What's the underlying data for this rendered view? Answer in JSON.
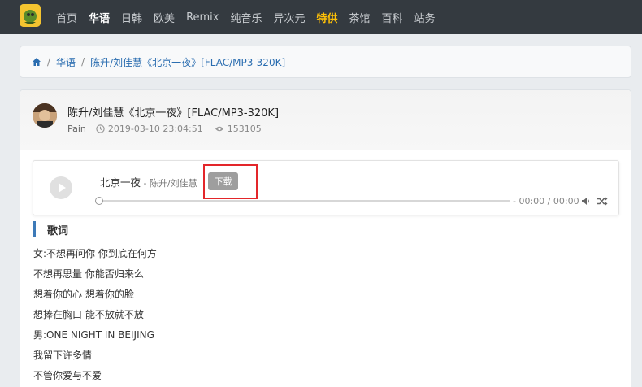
{
  "nav": {
    "items": [
      {
        "label": "首页"
      },
      {
        "label": "华语"
      },
      {
        "label": "日韩"
      },
      {
        "label": "欧美"
      },
      {
        "label": "Remix"
      },
      {
        "label": "纯音乐"
      },
      {
        "label": "异次元"
      },
      {
        "label": "特供"
      },
      {
        "label": "茶馆"
      },
      {
        "label": "百科"
      },
      {
        "label": "站务"
      }
    ],
    "active_index": 1,
    "highlight_index": 7
  },
  "breadcrumb": {
    "home_icon": "home-icon",
    "category": "华语",
    "current": "陈升/刘佳慧《北京一夜》[FLAC/MP3-320K]"
  },
  "post": {
    "title": "陈升/刘佳慧《北京一夜》[FLAC/MP3-320K]",
    "author": "Pain",
    "date": "2019-03-10 23:04:51",
    "views": "153105"
  },
  "player": {
    "song_title": "北京一夜",
    "artist": " - 陈升/刘佳慧",
    "download_label": "下载",
    "time": "- 00:00 / 00:00",
    "progress": 0
  },
  "lyrics": {
    "heading": "歌词",
    "lines": [
      "女:不想再问你 你到底在何方",
      "不想再思量 你能否归来么",
      "想着你的心 想着你的脸",
      "想捧在胸口 能不放就不放",
      "男:ONE NIGHT IN BEIJING",
      "我留下许多情",
      "不管你爱与不爱"
    ]
  },
  "colors": {
    "topbar": "#343a40",
    "accent": "#3d7ab8",
    "highlight_nav": "#ffc107",
    "annotation_box": "#e3262a"
  }
}
